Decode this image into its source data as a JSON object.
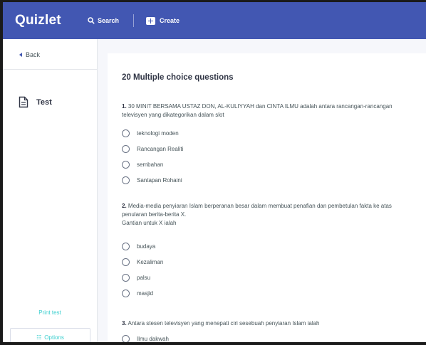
{
  "header": {
    "logo": "Quizlet",
    "search_label": "Search",
    "create_label": "Create"
  },
  "sidebar": {
    "back_label": "Back",
    "test_label": "Test",
    "print_label": "Print test",
    "options_label": "Options"
  },
  "main": {
    "heading": "20 Multiple choice questions",
    "questions": [
      {
        "number": "1.",
        "lines": [
          "30 MINIT BERSAMA USTAZ DON, AL-KULIYYAH dan CINTA ILMU adalah antara rancangan-rancangan",
          "televisyen yang dikategorikan dalam slot"
        ],
        "options": [
          "teknologi moden",
          "Rancangan Realiti",
          "sembahan",
          "Santapan Rohaini"
        ]
      },
      {
        "number": "2.",
        "lines": [
          "Media-media penyiaran Islam berperanan besar dalam membuat penafian dan pembetulan fakta ke atas",
          "penularan berita-berita X.",
          "Gantian untuk X ialah"
        ],
        "options": [
          "budaya",
          "Kezaliman",
          "palsu",
          "masjid"
        ]
      },
      {
        "number": "3.",
        "lines": [
          "Antara stesen televisyen yang menepati ciri sesebuah penyiaran Islam ialah"
        ],
        "options": [
          "Ilmu dakwah"
        ]
      }
    ]
  },
  "colors": {
    "brand": "#4257b2",
    "accent": "#3ccfcf",
    "background": "#f6f7fb"
  },
  "icons": {
    "search": "search-icon",
    "create": "create-icon",
    "back": "back-arrow-icon",
    "test": "document-icon",
    "options": "options-icon"
  }
}
